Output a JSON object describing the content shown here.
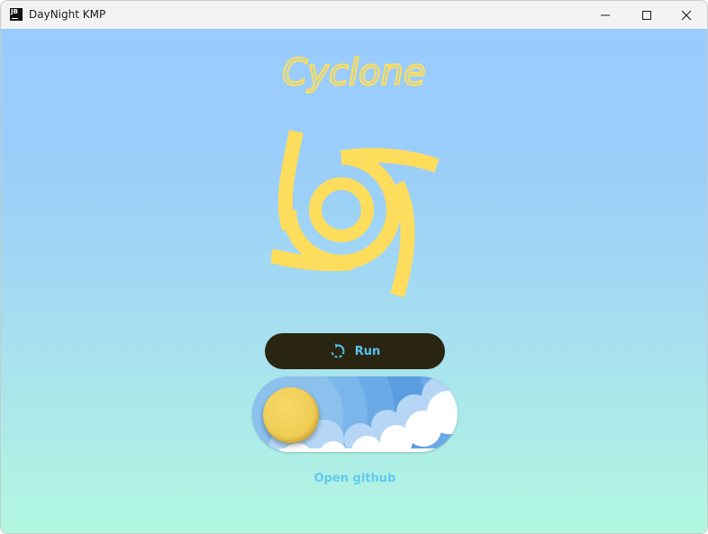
{
  "window": {
    "title": "DayNight KMP",
    "app_icon_text": "JB",
    "controls": {
      "minimize": "minimize-icon",
      "maximize": "maximize-icon",
      "close": "close-icon"
    }
  },
  "main": {
    "headline": "Cyclone",
    "logo_icon": "cyclone-icon",
    "run_button": {
      "label": "Run",
      "icon": "refresh-icon"
    },
    "day_night_toggle": {
      "state": "day",
      "icon": "sun-icon"
    },
    "github_link": "Open github"
  },
  "colors": {
    "gradient_top": "#99ccff",
    "gradient_bottom": "#b2f8e1",
    "accent_yellow": "#ffdd5c",
    "button_bg": "#2a2510",
    "button_text": "#55c4ee",
    "link_text": "#63c8ef"
  }
}
